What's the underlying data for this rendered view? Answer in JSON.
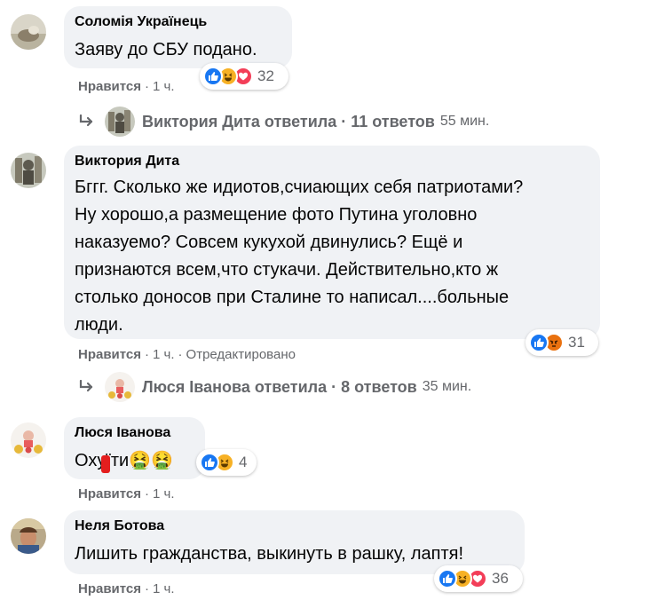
{
  "comments": [
    {
      "author": "Соломія Українець",
      "text": "Заяву до СБУ подано.",
      "like_label": "Нравится",
      "time": "1 ч.",
      "reactions": [
        "like",
        "haha",
        "love"
      ],
      "reaction_count": "32",
      "reply_summary": {
        "text": "Виктория Дита ответила · 11 ответов",
        "time": "55 мин."
      }
    },
    {
      "author": "Виктория Дита",
      "text_lines": [
        "Бггг. Сколько же идиотов,счиающих себя патриотами?",
        "Ну хорошо,а размещение фото Путина уголовно",
        "наказуемо? Совсем кукухой двинулись? Ещё и",
        "признаются всем,что стукачи. Действительно,кто ж",
        "столько доносов при Сталине то написал....больные",
        "люди."
      ],
      "like_label": "Нравится",
      "time": "1 ч.",
      "edited": "Отредактировано",
      "reactions": [
        "like",
        "angry"
      ],
      "reaction_count": "31",
      "reply_summary": {
        "text": "Люся Іванова ответила · 8 ответов",
        "time": "35 мин."
      }
    },
    {
      "author": "Люся Іванова",
      "text": "Охуїти🤮🤮",
      "like_label": "Нравится",
      "time": "1 ч.",
      "reactions": [
        "like",
        "haha"
      ],
      "reaction_count": "4"
    },
    {
      "author": "Неля Ботова",
      "text": "Лишить гражданства, выкинуть в рашку, лаптя!",
      "like_label": "Нравится",
      "time": "1 ч.",
      "reactions": [
        "like",
        "haha",
        "love"
      ],
      "reaction_count": "36"
    }
  ],
  "colors": {
    "bubble": "#f0f2f5",
    "secondary_text": "#65676b",
    "like_blue": "#1877f2",
    "love_red": "#f33e58",
    "haha_yellow": "#f7b125",
    "angry_orange": "#e9710f"
  },
  "icons": {
    "reply_arrow": "reply-arrow-icon",
    "like": "like-reaction-icon",
    "haha": "haha-reaction-icon",
    "love": "love-reaction-icon",
    "angry": "angry-reaction-icon"
  }
}
